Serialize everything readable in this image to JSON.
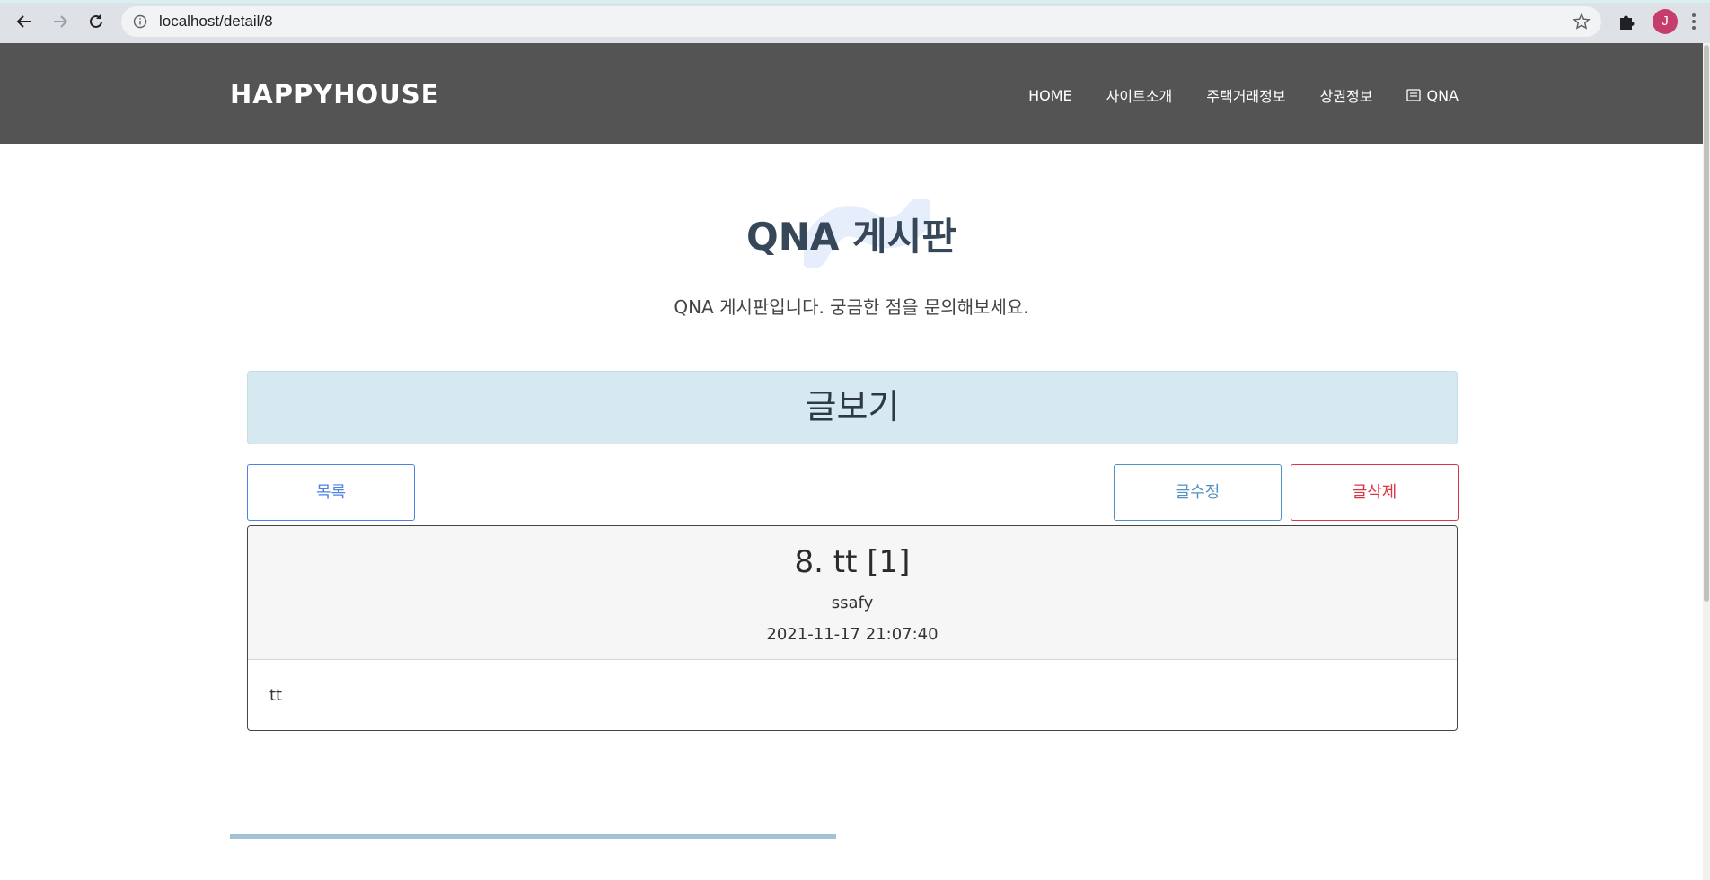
{
  "browser": {
    "url": "localhost/detail/8",
    "avatar_initial": "J"
  },
  "header": {
    "brand": "HAPPYHOUSE",
    "nav": [
      {
        "label": "HOME"
      },
      {
        "label": "사이트소개"
      },
      {
        "label": "주택거래정보"
      },
      {
        "label": "상권정보"
      },
      {
        "label": "QNA",
        "icon": "board-icon"
      }
    ]
  },
  "page": {
    "title": "QNA 게시판",
    "subtitle": "QNA 게시판입니다. 궁금한 점을 문의해보세요.",
    "section_title": "글보기"
  },
  "actions": {
    "list_label": "목록",
    "edit_label": "글수정",
    "delete_label": "글삭제"
  },
  "post": {
    "title": "8. tt [1]",
    "author": "ssafy",
    "date": "2021-11-17 21:07:40",
    "content": "tt"
  },
  "colors": {
    "header_bg": "#545454",
    "banner_bg": "#d6e8f0",
    "primary": "#4e80e6",
    "info": "#4f93c3",
    "danger": "#dc3545",
    "footer_accent": "#a3c2d6"
  }
}
